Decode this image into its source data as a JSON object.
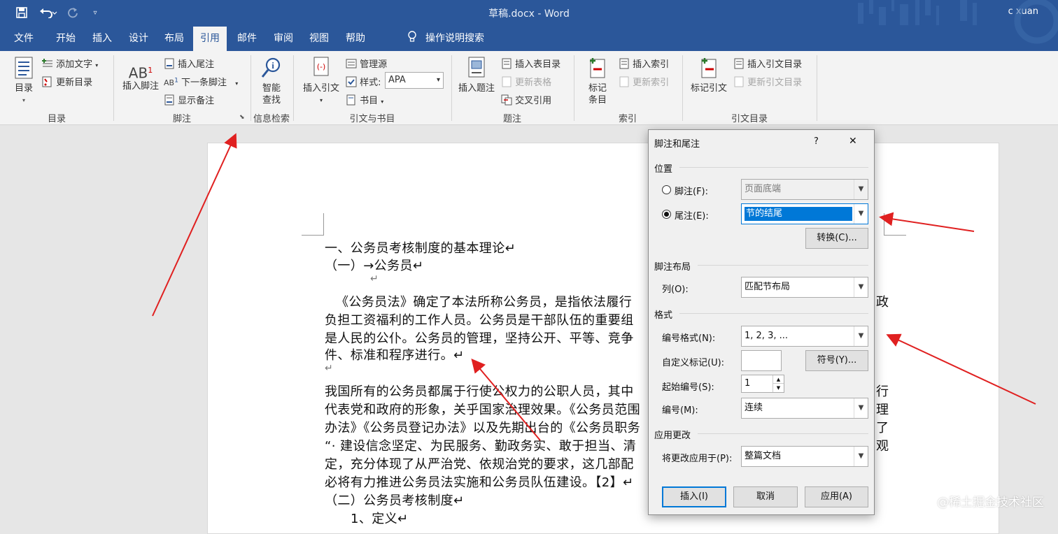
{
  "titlebar": {
    "title": "草稿.docx  -  Word",
    "user": "c xuan"
  },
  "tabs": [
    "文件",
    "开始",
    "插入",
    "设计",
    "布局",
    "引用",
    "邮件",
    "审阅",
    "视图",
    "帮助"
  ],
  "tell_me": "操作说明搜索",
  "ribbon": {
    "toc": {
      "btn": "目录",
      "add_text": "添加文字",
      "update": "更新目录",
      "group": "目录"
    },
    "footnotes": {
      "insert_footnote": "插入脚注",
      "insert_endnote": "插入尾注",
      "next_footnote": "下一条脚注",
      "show_notes": "显示备注",
      "group": "脚注"
    },
    "research": {
      "smart1": "智能",
      "smart2": "查找",
      "group": "信息检索"
    },
    "citations": {
      "insert_citation": "插入引文",
      "manage": "管理源",
      "style_label": "样式:",
      "style_value": "APA",
      "biblio": "书目",
      "group": "引文与书目"
    },
    "captions": {
      "insert_caption": "插入题注",
      "insert_tof": "插入表目录",
      "update_table": "更新表格",
      "crossref": "交叉引用",
      "group": "题注"
    },
    "index": {
      "mark1": "标记",
      "mark2": "条目",
      "insert_index": "插入索引",
      "update_index": "更新索引",
      "group": "索引"
    },
    "toa": {
      "mark_citation": "标记引文",
      "insert_toa": "插入引文目录",
      "update_toa": "更新引文目录",
      "group": "引文目录"
    }
  },
  "document": {
    "h1": "一、公务员考核制度的基本理论↵",
    "h2": "（一）→公务员↵",
    "blank1": "↵",
    "p1": [
      "《公务员法》确定了本法所称公务员，是指依法履行",
      "负担工资福利的工作人员。公务员是干部队伍的重要组",
      "是人民的公仆。公务员的管理，坚持公开、平等、竞争",
      "件、标准和程序进行。↵"
    ],
    "blank2": "↵",
    "p2": [
      "我国所有的公务员都属于行使公权力的公职人员，其中",
      "代表党和政府的形象，关乎国家治理效果。《公务员范围",
      "办法》《公务员登记办法》以及先期出台的《公务员职务",
      "“· 建设信念坚定、为民服务、勤政务实、敢于担当、清",
      "定，充分体现了从严治党、依规治党的要求，这几部配",
      "必将有力推进公务员法实施和公务员队伍建设。【2】↵"
    ],
    "right_chars": [
      "政",
      "行",
      "理",
      "了",
      "观"
    ],
    "h3": "（二）公务员考核制度↵",
    "h4": "1、定义↵"
  },
  "dialog": {
    "title": "脚注和尾注",
    "help": "?",
    "close": "✕",
    "position_label": "位置",
    "footnote_label": "脚注(F):",
    "footnote_value": "页面底端",
    "endnote_label": "尾注(E):",
    "endnote_value": "节的结尾",
    "convert": "转换(C)...",
    "layout_label": "脚注布局",
    "columns_label": "列(O):",
    "columns_value": "匹配节布局",
    "format_label": "格式",
    "number_format_label": "编号格式(N):",
    "number_format_value": "1, 2, 3, ...",
    "custom_mark_label": "自定义标记(U):",
    "symbol": "符号(Y)...",
    "start_label": "起始编号(S):",
    "start_value": "1",
    "numbering_label": "编号(M):",
    "numbering_value": "连续",
    "apply_changes_label": "应用更改",
    "apply_to_label": "将更改应用于(P):",
    "apply_to_value": "整篇文档",
    "insert": "插入(I)",
    "cancel": "取消",
    "apply": "应用(A)"
  },
  "watermark": "@稀土掘金技术社区",
  "colors": {
    "brand": "#2b579a",
    "arrow": "#e02020",
    "selection": "#0078d7"
  }
}
